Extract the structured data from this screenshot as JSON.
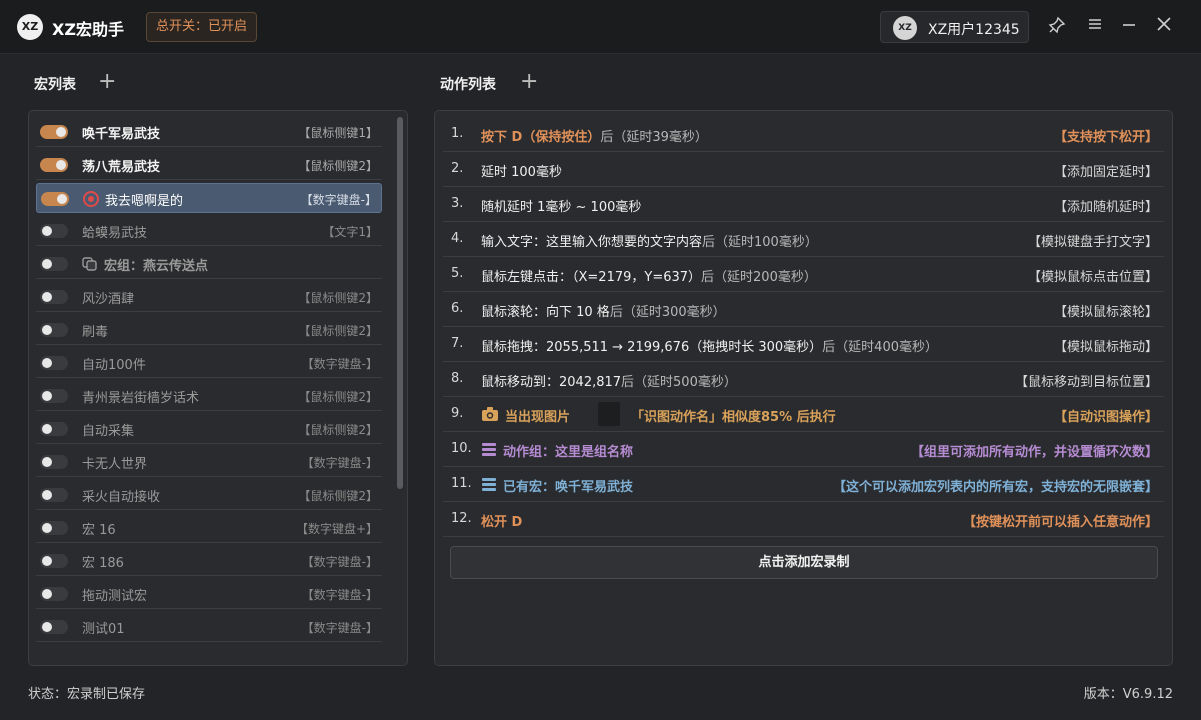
{
  "app": {
    "logo_text": "XZ",
    "title": "XZ宏助手"
  },
  "master_switch": "总开关：已开启",
  "user": {
    "avatar_text": "XZ",
    "name": "XZ用户12345"
  },
  "window_buttons": {
    "pin": "pin-icon",
    "menu": "menu-icon",
    "minimize": "minimize-icon",
    "close": "close-icon"
  },
  "macro_section": {
    "title": "宏列表",
    "add": "+"
  },
  "action_section": {
    "title": "动作列表",
    "add": "+"
  },
  "macros": [
    {
      "name": "唤千军易武技",
      "key": "【鼠标侧键1】",
      "on": true,
      "style": "bold"
    },
    {
      "name": "荡八荒易武技",
      "key": "【鼠标侧键2】",
      "on": true,
      "style": "bold"
    },
    {
      "name": "我去嗯啊是的",
      "key": "【数字键盘-】",
      "on": true,
      "style": "normal",
      "icon": "record-icon",
      "selected": true
    },
    {
      "name": "蛤蟆易武技",
      "key": "【文字1】",
      "on": false,
      "style": "dim"
    },
    {
      "name": "宏组：燕云传送点",
      "key": "",
      "on": false,
      "style": "dimbold",
      "icon": "group-icon"
    },
    {
      "name": "风沙酒肆",
      "key": "【鼠标侧键2】",
      "on": false,
      "style": "dim"
    },
    {
      "name": "刷毒",
      "key": "【鼠标侧键2】",
      "on": false,
      "style": "dim"
    },
    {
      "name": "自动100件",
      "key": "【数字键盘-】",
      "on": false,
      "style": "dim"
    },
    {
      "name": "青州景岩街樯岁话术",
      "key": "【鼠标侧键2】",
      "on": false,
      "style": "dim"
    },
    {
      "name": "自动采集",
      "key": "【鼠标侧键2】",
      "on": false,
      "style": "dim"
    },
    {
      "name": "卡无人世界",
      "key": "【数字键盘-】",
      "on": false,
      "style": "dim"
    },
    {
      "name": "采火自动接收",
      "key": "【鼠标侧键2】",
      "on": false,
      "style": "dim"
    },
    {
      "name": "宏 16",
      "key": "【数字键盘+】",
      "on": false,
      "style": "dim"
    },
    {
      "name": "宏 186",
      "key": "【数字键盘-】",
      "on": false,
      "style": "dim"
    },
    {
      "name": "拖动测试宏",
      "key": "【数字键盘-】",
      "on": false,
      "style": "dim"
    },
    {
      "name": "测试01",
      "key": "【数字键盘-】",
      "on": false,
      "style": "dim"
    }
  ],
  "actions": [
    {
      "num": "1.",
      "text": "按下 D（保持按住）",
      "suffix": "后（延时39毫秒）",
      "tag": "【支持按下松开】",
      "color": "orange-b",
      "tagcolor": "orange-b"
    },
    {
      "num": "2.",
      "text": "延时 100毫秒",
      "suffix": "",
      "tag": "【添加固定延时】"
    },
    {
      "num": "3.",
      "text": "随机延时 1毫秒 ~ 100毫秒",
      "suffix": "",
      "tag": "【添加随机延时】"
    },
    {
      "num": "4.",
      "text": "输入文字：这里输入你想要的文字内容",
      "suffix": "后（延时100毫秒）",
      "tag": "【模拟键盘手打文字】"
    },
    {
      "num": "5.",
      "text": "鼠标左键点击：（X=2179，Y=637）",
      "suffix": "后（延时200毫秒）",
      "tag": "【模拟鼠标点击位置】"
    },
    {
      "num": "6.",
      "text": "鼠标滚轮：向下 10 格",
      "suffix": "后（延时300毫秒）",
      "tag": "【模拟鼠标滚轮】"
    },
    {
      "num": "7.",
      "text": "鼠标拖拽：2055,511 → 2199,676（拖拽时长 300毫秒）",
      "suffix": "后（延时400毫秒）",
      "tag": "【模拟鼠标拖动】"
    },
    {
      "num": "8.",
      "text": "鼠标移动到：2042,817",
      "suffix": "后（延时500毫秒）",
      "tag": "【鼠标移动到目标位置】"
    },
    {
      "num": "9.",
      "text": "当出现图片",
      "text2": "「识图动作名」相似度85% 后执行",
      "suffix": "",
      "tag": "【自动识图操作】",
      "color": "gold",
      "tagcolor": "gold",
      "icon": "camera-icon"
    },
    {
      "num": "10.",
      "text": "动作组：这里是组名称",
      "suffix": "",
      "tag": "【组里可添加所有动作，并设置循环次数】",
      "color": "purple",
      "tagcolor": "purple",
      "icon": "list-icon"
    },
    {
      "num": "11.",
      "text": "已有宏：唤千军易武技",
      "suffix": "",
      "tag": "【这个可以添加宏列表内的所有宏，支持宏的无限嵌套】",
      "color": "blue",
      "tagcolor": "blue",
      "icon": "list-icon"
    },
    {
      "num": "12.",
      "text": "松开 D",
      "suffix": "",
      "tag": "【按键松开前可以插入任意动作】",
      "color": "orange-b",
      "tagcolor": "orange-b"
    }
  ],
  "add_record_button": "点击添加宏录制",
  "status": "状态：宏录制已保存",
  "version": "版本：V6.9.12"
}
